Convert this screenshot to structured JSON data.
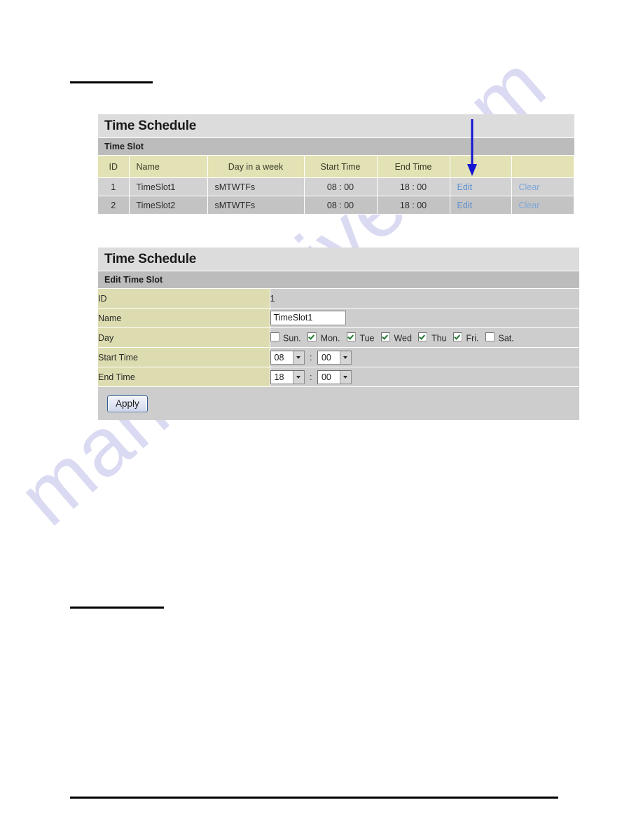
{
  "page": {
    "redaction_rules": [
      "top-heading-rule",
      "mid-heading-rule",
      "footer-rule"
    ],
    "watermark_text": "manualshive.com",
    "accent_link_color": "#5b8fcf",
    "annotation_arrow_color": "#1414d2",
    "header_fill": "#dcdcdc",
    "subheader_fill": "#bcbcbc",
    "label_fill": "#dcdcb0",
    "value_fill": "#cdcdcd"
  },
  "timeslot_panel": {
    "title": "Time Schedule",
    "subtitle": "Time Slot",
    "columns": [
      "ID",
      "Name",
      "Day in a week",
      "Start Time",
      "End Time",
      "",
      ""
    ],
    "rows": [
      {
        "id": "1",
        "name": "TimeSlot1",
        "days": "sMTWTFs",
        "start": "08 : 00",
        "end": "18 : 00",
        "edit": "Edit",
        "clear": "Clear"
      },
      {
        "id": "2",
        "name": "TimeSlot2",
        "days": "sMTWTFs",
        "start": "08 : 00",
        "end": "18 : 00",
        "edit": "Edit",
        "clear": "Clear"
      }
    ]
  },
  "edit_panel": {
    "title": "Time Schedule",
    "subtitle": "Edit Time Slot",
    "labels": {
      "id": "ID",
      "name": "Name",
      "day": "Day",
      "start_time": "Start Time",
      "end_time": "End Time"
    },
    "values": {
      "id": "1",
      "name": "TimeSlot1"
    },
    "days": [
      {
        "label": "Sun.",
        "checked": false
      },
      {
        "label": "Mon.",
        "checked": true
      },
      {
        "label": "Tue",
        "checked": true
      },
      {
        "label": "Wed",
        "checked": true
      },
      {
        "label": "Thu",
        "checked": true
      },
      {
        "label": "Fri.",
        "checked": true
      },
      {
        "label": "Sat.",
        "checked": false
      }
    ],
    "start_time": {
      "hour": "08",
      "minute": "00",
      "separator": ":"
    },
    "end_time": {
      "hour": "18",
      "minute": "00",
      "separator": ":"
    },
    "apply_label": "Apply"
  }
}
